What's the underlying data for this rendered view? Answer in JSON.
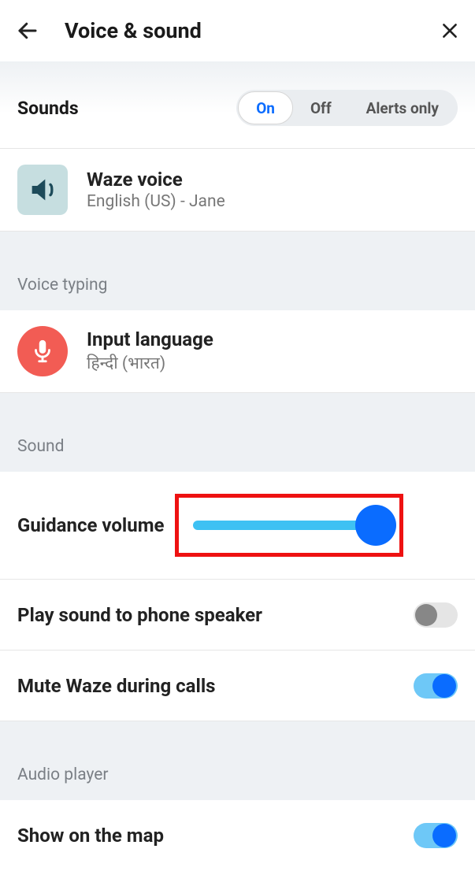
{
  "header": {
    "title": "Voice & sound"
  },
  "sounds": {
    "label": "Sounds",
    "options": [
      "On",
      "Off",
      "Alerts only"
    ],
    "active": "On"
  },
  "waze_voice": {
    "title": "Waze voice",
    "subtitle": "English (US) - Jane"
  },
  "voice_typing": {
    "section": "Voice typing",
    "title": "Input language",
    "subtitle": "हिन्दी (भारत)"
  },
  "sound_section": {
    "section": "Sound",
    "guidance": {
      "label": "Guidance volume",
      "value": 100
    },
    "play_speaker": {
      "label": "Play sound to phone speaker",
      "value": false
    },
    "mute_calls": {
      "label": "Mute Waze during calls",
      "value": true
    }
  },
  "audio_player": {
    "section": "Audio player",
    "show_map": {
      "label": "Show on the map",
      "value": true
    }
  }
}
